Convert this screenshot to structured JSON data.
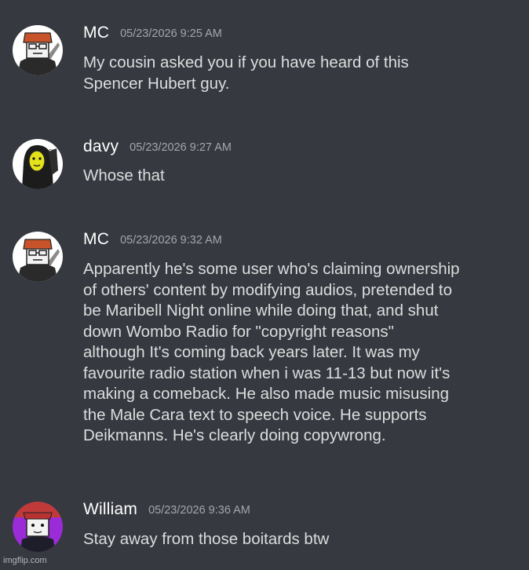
{
  "messages": [
    {
      "author": "MC",
      "timestamp": "05/23/2026 9:25 AM",
      "avatar_icon": "mc-avatar-icon",
      "text": "My cousin asked you if you have heard of this\nSpencer Hubert guy."
    },
    {
      "author": "davy",
      "timestamp": "05/23/2026 9:27 AM",
      "avatar_icon": "davy-avatar-icon",
      "text": "Whose that"
    },
    {
      "author": "MC",
      "timestamp": "05/23/2026 9:32 AM",
      "avatar_icon": "mc-avatar-icon",
      "text": "Apparently he's some user who's claiming ownership\nof others' content by modifying audios, pretended to\nbe Maribell Night online while doing that, and shut\ndown Wombo Radio for \"copyright reasons\"\nalthough It's coming back years later. It was my\nfavourite radio station when i was 11-13 but now it's\nmaking a comeback. He also made music misusing\nthe Male Cara text to speech voice. He supports\nDeikmanns. He's clearly doing copywrong."
    },
    {
      "author": "William",
      "timestamp": "05/23/2026 9:36 AM",
      "avatar_icon": "william-avatar-icon",
      "text": "Stay away from those boitards btw"
    }
  ],
  "watermark": "imgflip.com",
  "colors": {
    "background": "#36393f",
    "username": "#ffffff",
    "timestamp": "#a3a6aa",
    "message_text": "#dcddde"
  }
}
